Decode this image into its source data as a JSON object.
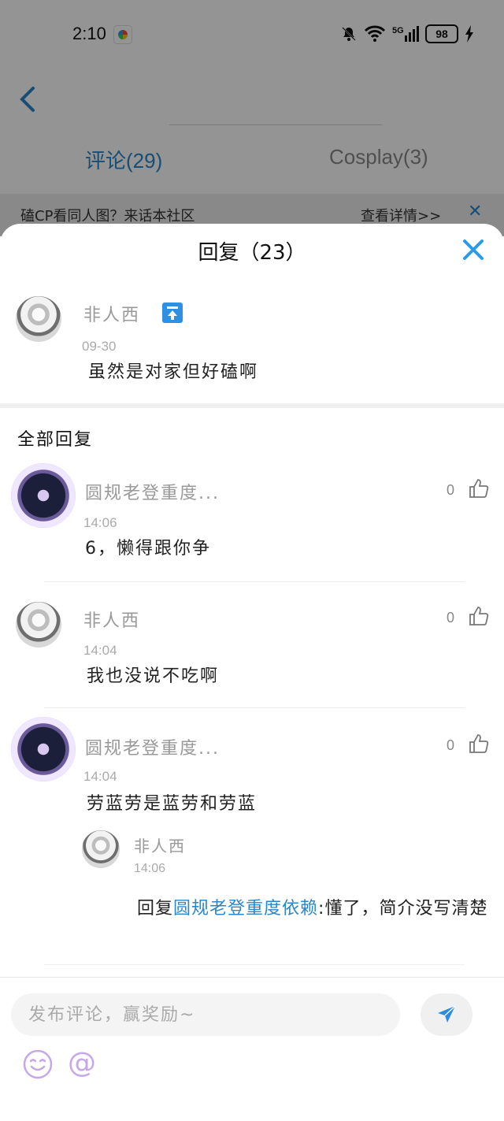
{
  "status_bar": {
    "time": "2:10",
    "battery": "98",
    "network": "5G"
  },
  "background_page": {
    "tabs": [
      {
        "label": "评论(29)"
      },
      {
        "label": "Cosplay(3)"
      }
    ],
    "promo": {
      "text": "磕CP看同人图？来话本社区",
      "link": "查看详情>>"
    }
  },
  "sheet": {
    "title": "回复（23）",
    "original_comment": {
      "user": "非人西",
      "date": "09-30",
      "text": "虽然是对家但好磕啊"
    },
    "section_title": "全部回复",
    "replies": [
      {
        "user": "圆规老登重度...",
        "time": "14:06",
        "text": "6，懒得跟你争",
        "likes": "0"
      },
      {
        "user": "非人西",
        "time": "14:04",
        "text": "我也没说不吃啊",
        "likes": "0"
      },
      {
        "user": "圆规老登重度...",
        "time": "14:04",
        "text": "劳蓝劳是蓝劳和劳蓝",
        "likes": "0",
        "sub_reply": {
          "user": "非人西",
          "time": "14:06",
          "prefix": "回复",
          "mention": "圆规老登重度依赖",
          "text": ":懂了，简介没写清楚"
        }
      }
    ]
  },
  "composer": {
    "placeholder": "发布评论，赢奖励~"
  },
  "colors": {
    "accent": "#2a86c8",
    "icon_purple": "#c6a8e8"
  }
}
